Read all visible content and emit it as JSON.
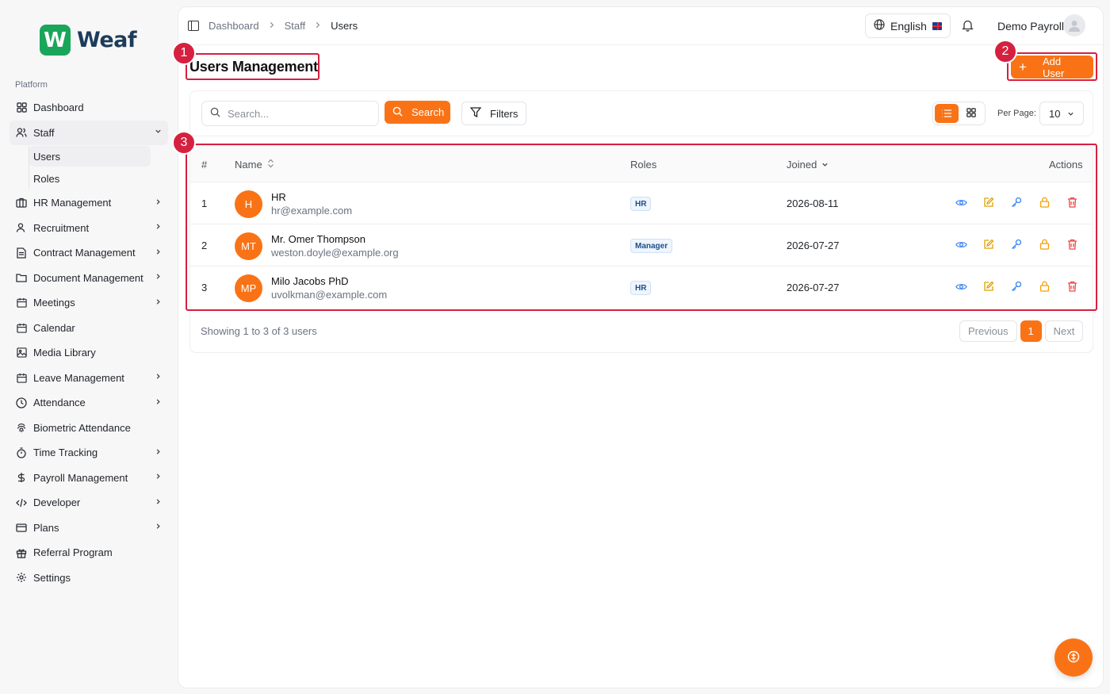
{
  "brand": {
    "name": "Weaf",
    "mark": "W"
  },
  "sidebar": {
    "section_label": "Platform",
    "items": [
      {
        "label": "Dashboard",
        "icon": "grid-icon",
        "chevron": false
      },
      {
        "label": "Staff",
        "icon": "users-icon",
        "chevron": true,
        "expanded": true,
        "children": [
          {
            "label": "Users",
            "active": true
          },
          {
            "label": "Roles"
          }
        ]
      },
      {
        "label": "HR Management",
        "icon": "briefcase-icon",
        "chevron": true
      },
      {
        "label": "Recruitment",
        "icon": "user-plus-icon",
        "chevron": true
      },
      {
        "label": "Contract Management",
        "icon": "document-icon",
        "chevron": true
      },
      {
        "label": "Document Management",
        "icon": "folder-icon",
        "chevron": true
      },
      {
        "label": "Meetings",
        "icon": "calendar-icon",
        "chevron": true
      },
      {
        "label": "Calendar",
        "icon": "calendar-icon",
        "chevron": false
      },
      {
        "label": "Media Library",
        "icon": "image-icon",
        "chevron": false
      },
      {
        "label": "Leave Management",
        "icon": "calendar-icon",
        "chevron": true
      },
      {
        "label": "Attendance",
        "icon": "clock-icon",
        "chevron": true
      },
      {
        "label": "Biometric Attendance",
        "icon": "fingerprint-icon",
        "chevron": false
      },
      {
        "label": "Time Tracking",
        "icon": "timer-icon",
        "chevron": true
      },
      {
        "label": "Payroll Management",
        "icon": "dollar-icon",
        "chevron": true
      },
      {
        "label": "Developer",
        "icon": "code-icon",
        "chevron": true
      },
      {
        "label": "Plans",
        "icon": "card-icon",
        "chevron": true
      },
      {
        "label": "Referral Program",
        "icon": "gift-icon",
        "chevron": false
      },
      {
        "label": "Settings",
        "icon": "gear-icon",
        "chevron": false
      }
    ]
  },
  "header": {
    "breadcrumb": [
      "Dashboard",
      "Staff",
      "Users"
    ],
    "language": "English",
    "user_name": "Demo Payroll"
  },
  "page": {
    "title": "Users Management",
    "add_button": "Add User"
  },
  "toolbar": {
    "search_placeholder": "Search...",
    "search_button": "Search",
    "filters_button": "Filters",
    "per_page_label": "Per Page:",
    "per_page_value": "10"
  },
  "table": {
    "columns": {
      "index": "#",
      "name": "Name",
      "roles": "Roles",
      "joined": "Joined",
      "actions": "Actions"
    },
    "rows": [
      {
        "index": "1",
        "initials": "H",
        "name": "HR",
        "email": "hr@example.com",
        "role": "HR",
        "joined": "2026-08-11"
      },
      {
        "index": "2",
        "initials": "MT",
        "name": "Mr. Omer Thompson",
        "email": "weston.doyle@example.org",
        "role": "Manager",
        "joined": "2026-07-27"
      },
      {
        "index": "3",
        "initials": "MP",
        "name": "Milo Jacobs PhD",
        "email": "uvolkman@example.com",
        "role": "HR",
        "joined": "2026-07-27"
      }
    ]
  },
  "pagination": {
    "summary": "Showing 1 to 3 of 3 users",
    "previous": "Previous",
    "current": "1",
    "next": "Next"
  },
  "annotations": [
    "1",
    "2",
    "3"
  ],
  "colors": {
    "accent": "#f97316",
    "annotation": "#d6203f",
    "brand_green": "#1aa65a",
    "brand_navy": "#1d3c5a"
  }
}
